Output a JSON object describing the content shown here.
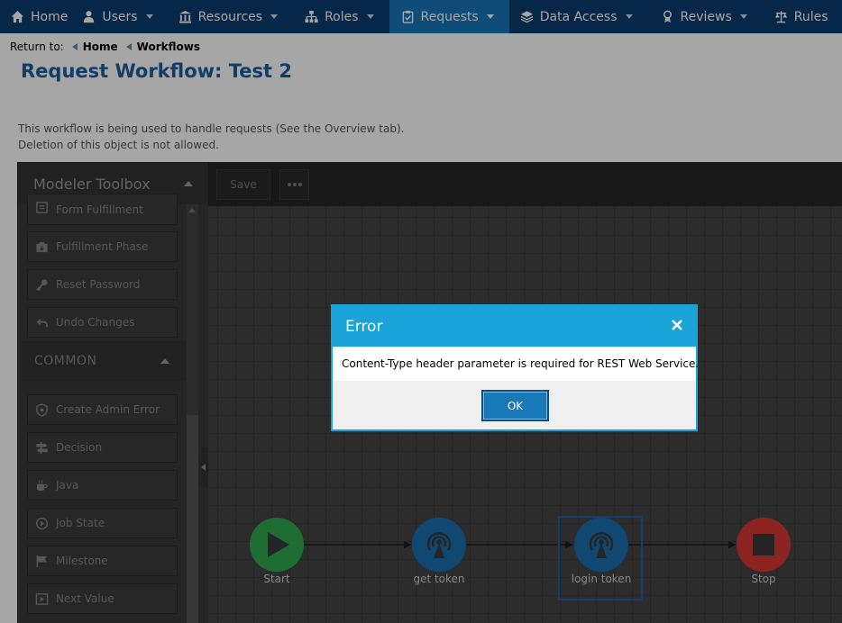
{
  "nav": {
    "items": [
      {
        "label": "Home",
        "icon": "home-icon"
      },
      {
        "label": "Users",
        "icon": "users-icon"
      },
      {
        "label": "Resources",
        "icon": "building-icon"
      },
      {
        "label": "Roles",
        "icon": "sitemap-icon"
      },
      {
        "label": "Requests",
        "icon": "clipboard-check-icon",
        "active": true
      },
      {
        "label": "Data Access",
        "icon": "layers-icon"
      },
      {
        "label": "Reviews",
        "icon": "certificate-icon"
      },
      {
        "label": "Rules",
        "icon": "scale-icon"
      }
    ]
  },
  "breadcrumb": {
    "prefix": "Return to:",
    "links": [
      "Home",
      "Workflows"
    ]
  },
  "page": {
    "title": "Request Workflow: Test 2",
    "info_line1": "This workflow is being used to handle requests (See the Overview tab).",
    "info_line2": "Deletion of this object is not allowed."
  },
  "toolbox": {
    "title": "Modeler Toolbox",
    "items_top": [
      {
        "label": "Form Fulfillment",
        "icon": "form-icon"
      },
      {
        "label": "Fulfillment Phase",
        "icon": "inbox-icon"
      },
      {
        "label": "Reset Password",
        "icon": "key-icon"
      },
      {
        "label": "Undo Changes",
        "icon": "undo-icon"
      }
    ],
    "section_common": "COMMON",
    "items_common": [
      {
        "label": "Create Admin Error",
        "icon": "shield-icon"
      },
      {
        "label": "Decision",
        "icon": "signpost-icon"
      },
      {
        "label": "Java",
        "icon": "coffee-icon"
      },
      {
        "label": "Job State",
        "icon": "play-circle-icon"
      },
      {
        "label": "Milestone",
        "icon": "flag-icon"
      },
      {
        "label": "Next Value",
        "icon": "next-icon"
      }
    ]
  },
  "canvas": {
    "save_label": "Save",
    "nodes": [
      {
        "label": "Start",
        "kind": "start"
      },
      {
        "label": "get token",
        "kind": "service"
      },
      {
        "label": "login token",
        "kind": "service",
        "selected": true
      },
      {
        "label": "Stop",
        "kind": "stop"
      }
    ]
  },
  "modal": {
    "title": "Error",
    "message": "Content-Type header parameter is required for REST Web Service.",
    "ok_label": "OK"
  },
  "colors": {
    "nav_bg": "#0a3d6e",
    "nav_active": "#1a75b8",
    "title_blue": "#1b5f9e",
    "modal_accent": "#1aa3d9",
    "start_green": "#2fa84f",
    "stop_red": "#d83a34",
    "service_blue": "#1a6fb0"
  }
}
